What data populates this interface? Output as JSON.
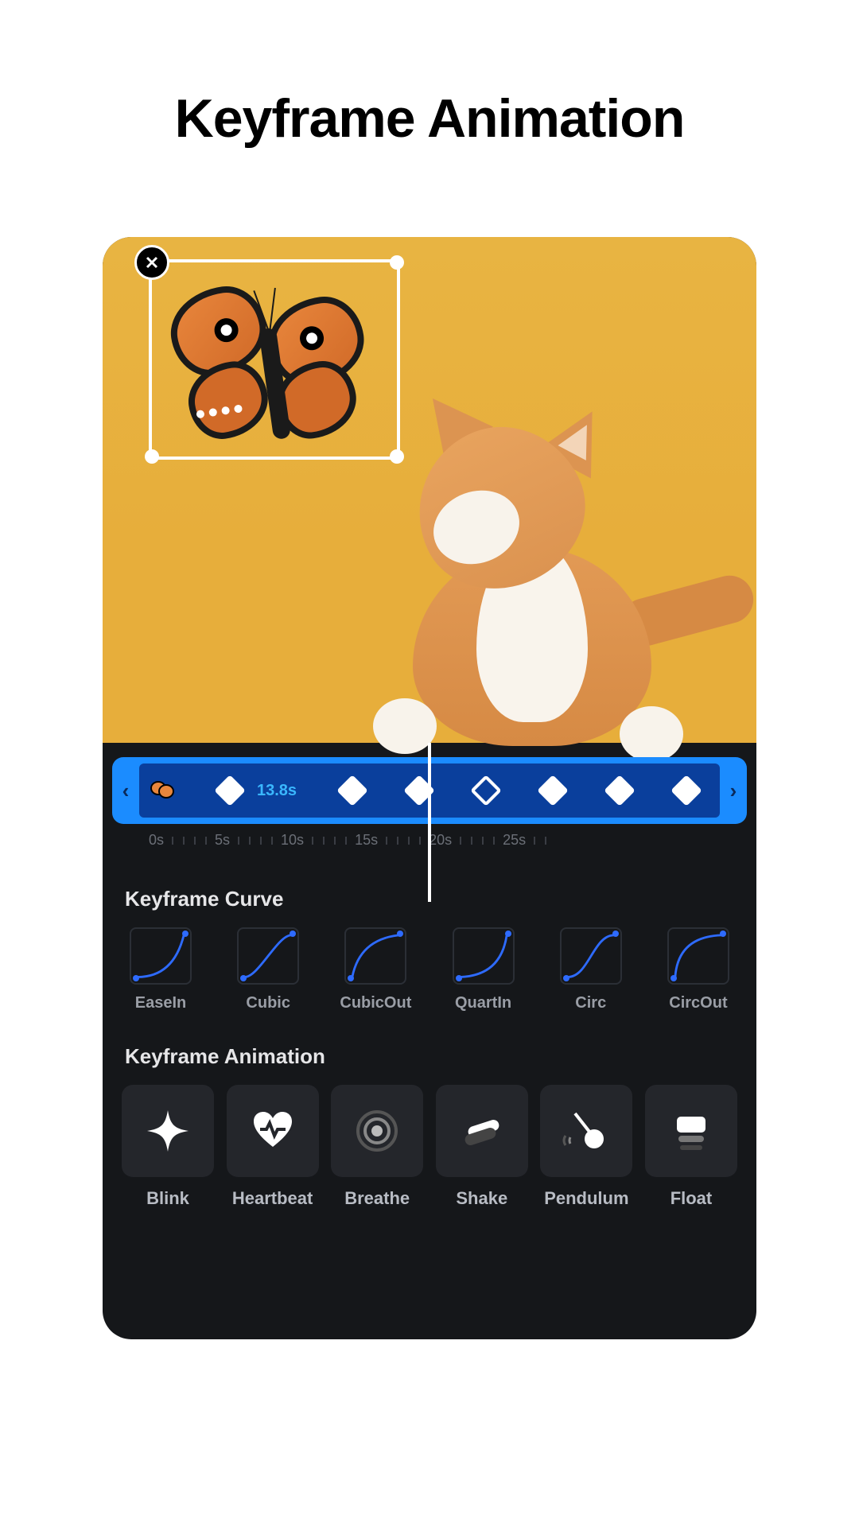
{
  "page_title": "Keyframe Animation",
  "canvas": {
    "sticker_name": "butterfly-sticker",
    "background_subject": "cat-on-yellow"
  },
  "timeline": {
    "current_time_label": "13.8s",
    "ruler_labels": [
      "0s",
      "5s",
      "10s",
      "15s",
      "20s",
      "25s"
    ],
    "keyframe_count": 7
  },
  "curve_section": {
    "label": "Keyframe Curve",
    "curves": [
      {
        "name": "EaseIn"
      },
      {
        "name": "Cubic"
      },
      {
        "name": "CubicOut"
      },
      {
        "name": "QuartIn"
      },
      {
        "name": "Circ"
      },
      {
        "name": "CircOut"
      }
    ]
  },
  "anim_section": {
    "label": "Keyframe Animation",
    "presets": [
      {
        "name": "Blink"
      },
      {
        "name": "Heartbeat"
      },
      {
        "name": "Breathe"
      },
      {
        "name": "Shake"
      },
      {
        "name": "Pendulum"
      },
      {
        "name": "Float"
      }
    ]
  }
}
